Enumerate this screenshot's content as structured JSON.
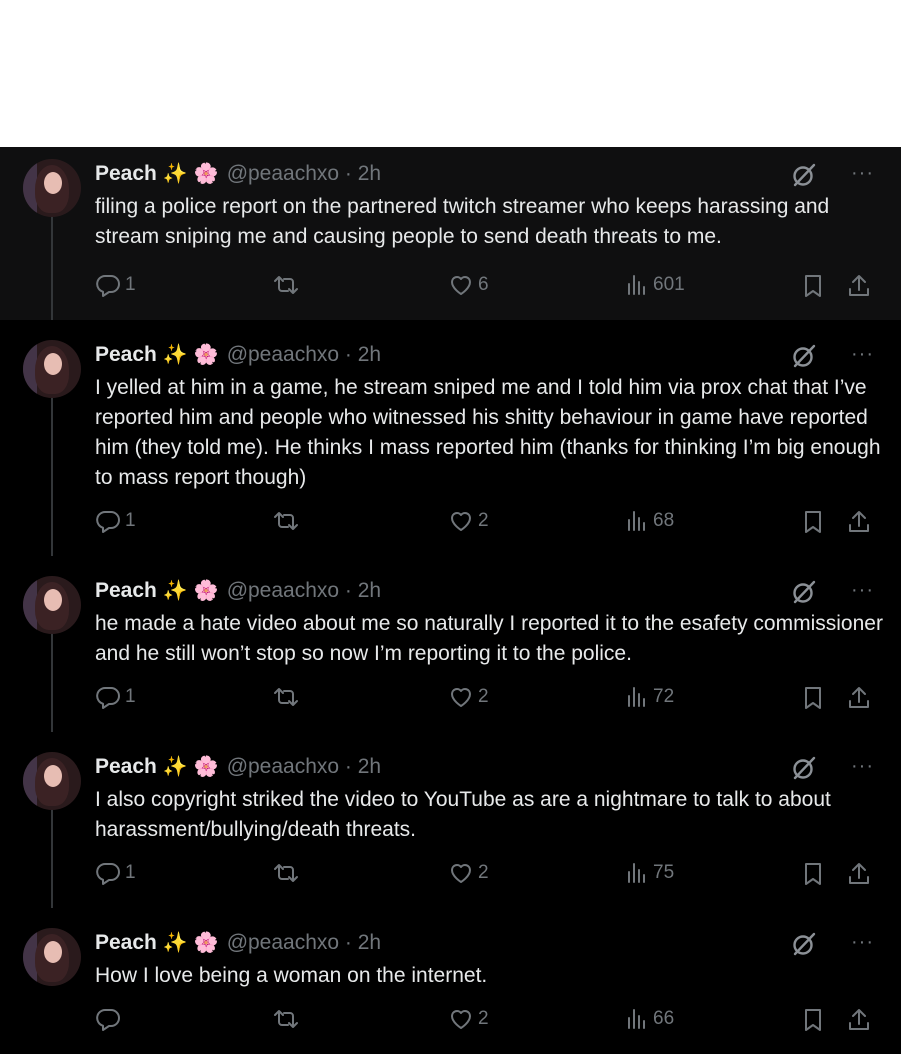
{
  "app": {
    "accent": "#1d9bf0",
    "background": "#000000",
    "text_color": "#e7e9ea",
    "muted_color": "#71767b"
  },
  "author": {
    "name": "Peach",
    "emoji_1": "✨",
    "emoji_2": "🌸",
    "handle": "@peaachxo · 2h"
  },
  "tweets": [
    {
      "text": "filing a police report on the partnered twitch streamer who keeps harassing and stream sniping me and causing people to send death threats to me.",
      "replies": "1",
      "reposts": "",
      "likes": "6",
      "views": "601"
    },
    {
      "text": "I yelled at him in a game, he stream sniped me and I told him via prox chat that I’ve reported him and people who witnessed his shitty behaviour in game have reported him (they told me). He thinks I mass reported him (thanks for thinking I’m big enough to mass report though)",
      "replies": "1",
      "reposts": "",
      "likes": "2",
      "views": "68"
    },
    {
      "text": "he made a hate video about me so naturally I reported it to the esafety commissioner and he still won’t stop so now I’m reporting it to the police.",
      "replies": "1",
      "reposts": "",
      "likes": "2",
      "views": "72"
    },
    {
      "text": "I also copyright striked the video to YouTube as are a nightmare to talk to about harassment/bullying/death threats.",
      "replies": "1",
      "reposts": "",
      "likes": "2",
      "views": "75"
    },
    {
      "text": "How I love being a woman on the internet.",
      "replies": "",
      "reposts": "",
      "likes": "2",
      "views": "66"
    }
  ],
  "icons": {
    "reply": "reply-icon",
    "repost": "repost-icon",
    "like": "like-icon",
    "views": "views-icon",
    "bookmark": "bookmark-icon",
    "share": "share-icon",
    "grok": "grok-icon",
    "more": "more-icon"
  },
  "more_glyph": "···"
}
